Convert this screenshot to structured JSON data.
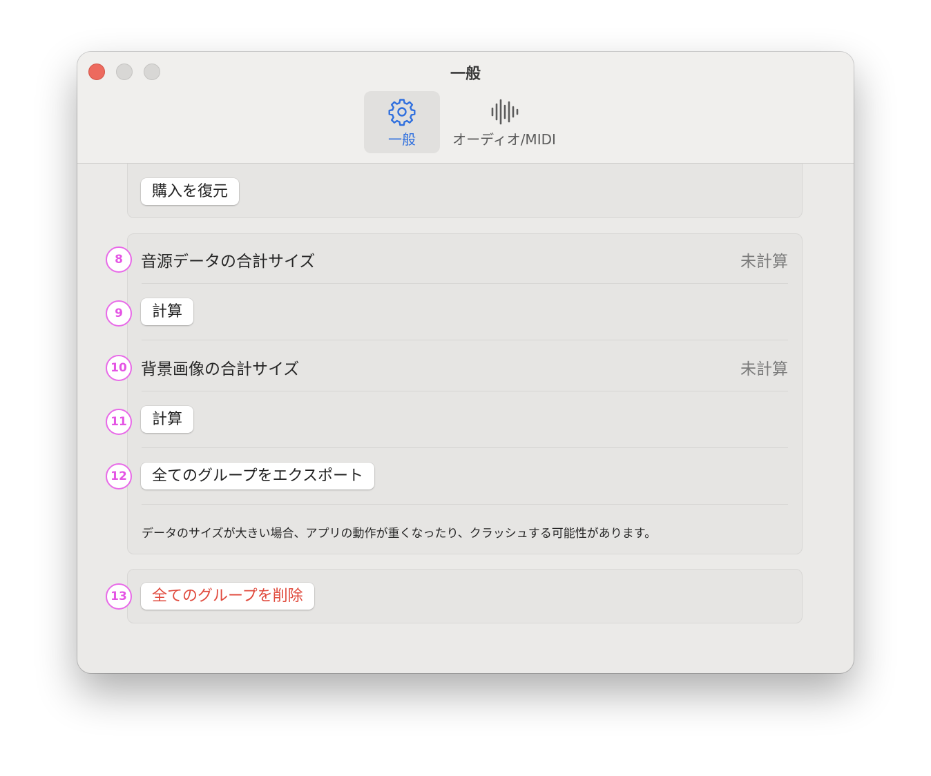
{
  "window": {
    "title": "一般"
  },
  "toolbar": {
    "tabs": [
      {
        "label": "一般",
        "icon": "gear-icon",
        "selected": true
      },
      {
        "label": "オーディオ/MIDI",
        "icon": "waveform-icon",
        "selected": false
      }
    ]
  },
  "sections": {
    "restore": {
      "button_label": "購入を復元"
    },
    "data": {
      "sound_size_label": "音源データの合計サイズ",
      "sound_size_value": "未計算",
      "sound_calc_button": "計算",
      "bg_size_label": "背景画像の合計サイズ",
      "bg_size_value": "未計算",
      "bg_calc_button": "計算",
      "export_button": "全てのグループをエクスポート",
      "note": "データのサイズが大きい場合、アプリの動作が重くなったり、クラッシュする可能性があります。"
    },
    "delete": {
      "delete_button": "全てのグループを削除"
    }
  },
  "annotations": [
    "8",
    "9",
    "10",
    "11",
    "12",
    "13"
  ],
  "colors": {
    "accent": "#2f6fde",
    "danger": "#e0493c",
    "annotation": "#e454e4",
    "close_button": "#ed6a5e"
  }
}
